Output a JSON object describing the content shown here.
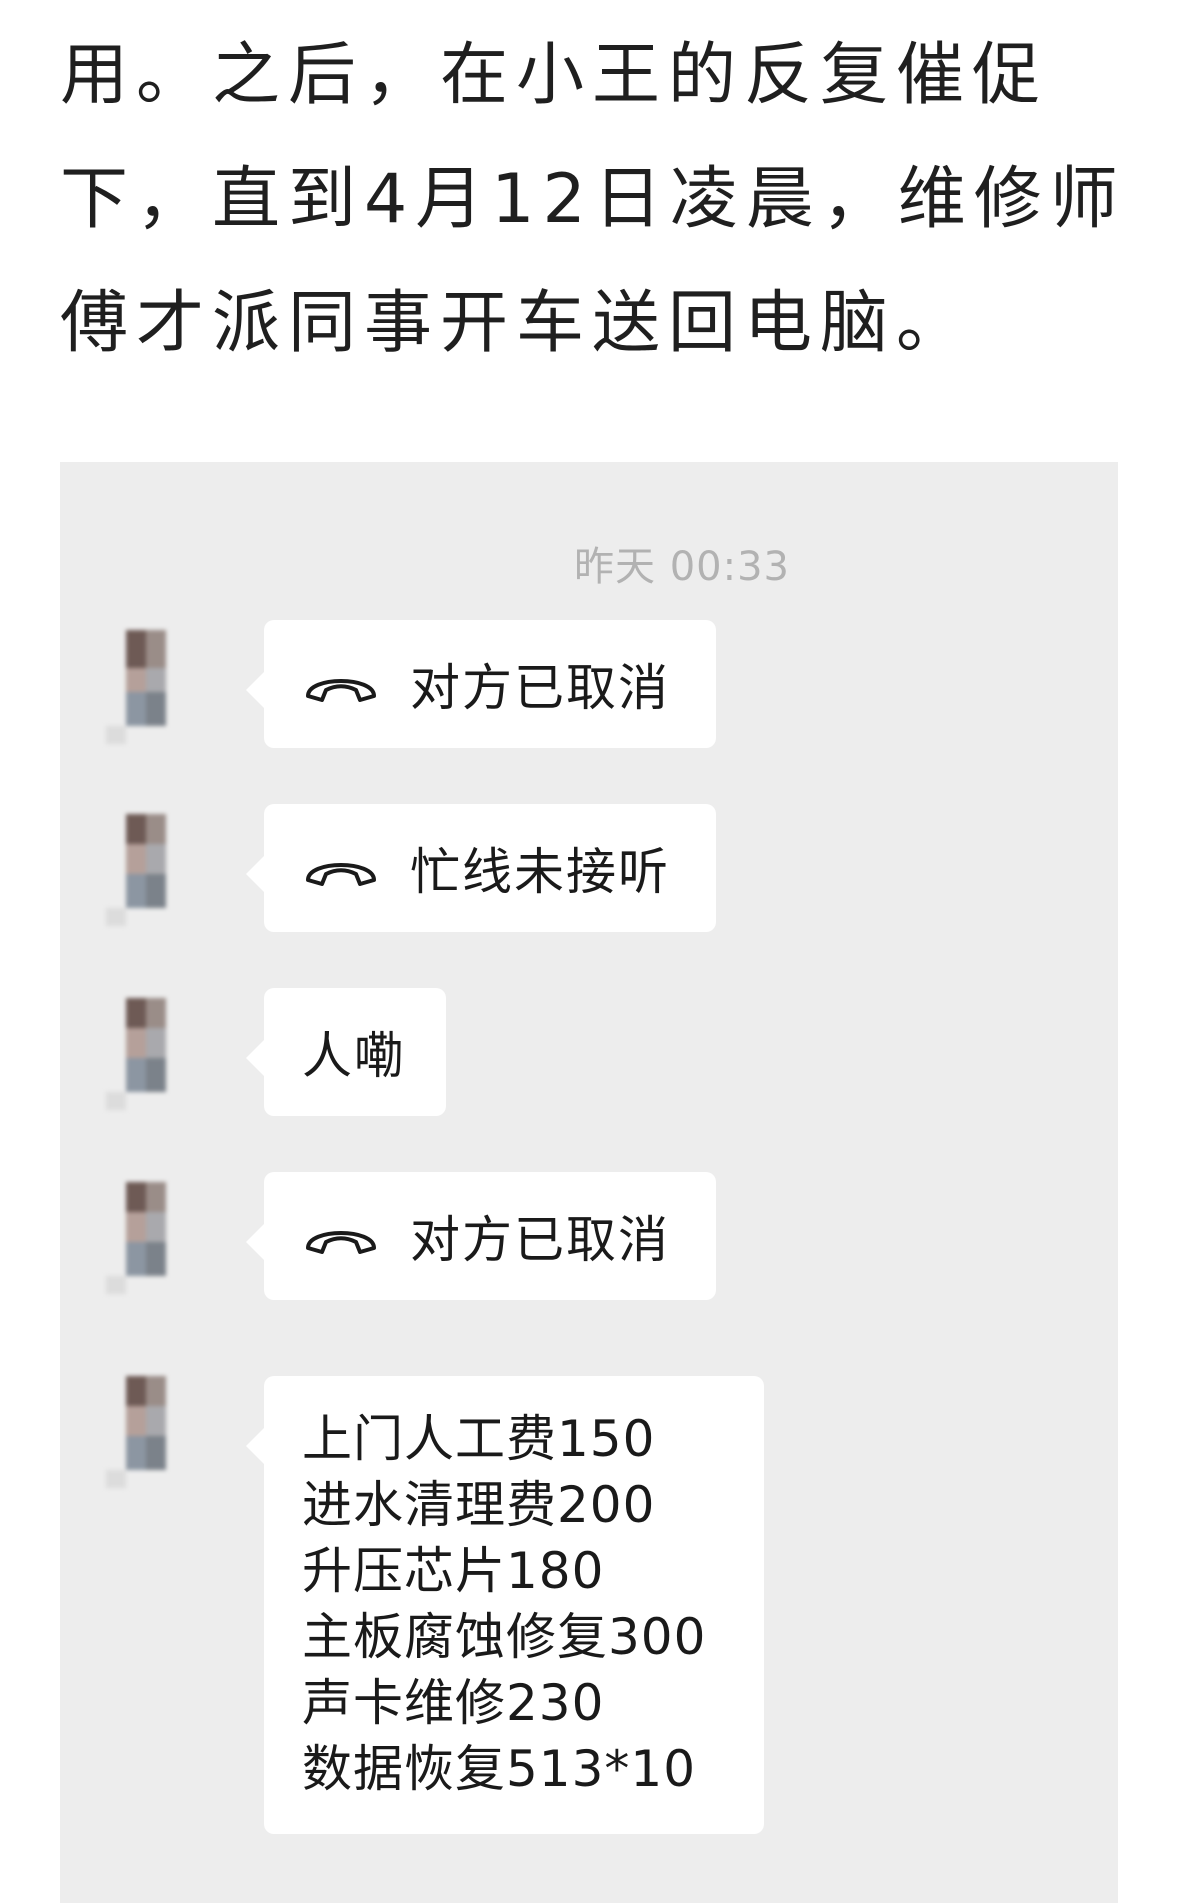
{
  "article": {
    "lines": [
      "用。之后，在小王的反复催促",
      "下，直到4月12日凌晨，维修师",
      "傅才派同事开车送回电脑。"
    ]
  },
  "chat": {
    "timestamp": "昨天 00:33",
    "messages": [
      {
        "type": "call",
        "icon": "phone-hangup-icon",
        "text": "对方已取消"
      },
      {
        "type": "call",
        "icon": "phone-hangup-icon",
        "text": "忙线未接听"
      },
      {
        "type": "text",
        "text": "人嘞"
      },
      {
        "type": "call",
        "icon": "phone-hangup-icon",
        "text": "对方已取消"
      },
      {
        "type": "list",
        "lines": [
          "上门人工费150",
          "进水清理费200",
          "升压芯片180",
          "主板腐蚀修复300",
          "声卡维修230",
          "数据恢复513*10"
        ]
      }
    ]
  },
  "colors": {
    "chat_background": "#ededed",
    "bubble": "#ffffff",
    "timestamp": "#b2b2b2",
    "text": "#1a1a1a"
  }
}
